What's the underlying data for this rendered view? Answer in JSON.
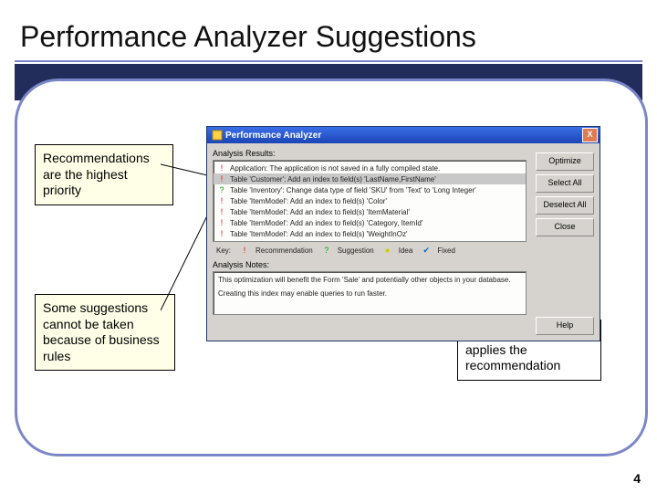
{
  "slide": {
    "title": "Performance Analyzer Suggestions",
    "page_number": "4"
  },
  "callouts": {
    "c1": "Recommendations are the highest priority",
    "c2": "Some suggestions cannot be taken because of business rules",
    "c3": "The optimize button applies the recommendation"
  },
  "dialog": {
    "title": "Performance Analyzer",
    "close": "X",
    "analysis_results_label": "Analysis Results:",
    "results": [
      {
        "icon": "reco",
        "text": "Application: The application is not saved in a fully compiled state."
      },
      {
        "icon": "reco",
        "text": "Table 'Customer': Add an index to field(s) 'LastName,FirstName'"
      },
      {
        "icon": "sugg",
        "text": "Table 'Inventory': Change data type of field 'SKU' from 'Text' to 'Long Integer'"
      },
      {
        "icon": "reco",
        "text": "Table 'ItemModel': Add an index to field(s) 'Color'"
      },
      {
        "icon": "reco",
        "text": "Table 'ItemModel': Add an index to field(s) 'ItemMaterial'"
      },
      {
        "icon": "reco",
        "text": "Table 'ItemModel': Add an index to field(s) 'Category, ItemId'"
      },
      {
        "icon": "reco",
        "text": "Table 'ItemModel': Add an index to field(s) 'WeightInOz'"
      }
    ],
    "key_label": "Key:",
    "key": {
      "recommendation": "Recommendation",
      "suggestion": "Suggestion",
      "idea": "Idea",
      "fixed": "Fixed"
    },
    "analysis_notes_label": "Analysis Notes:",
    "notes_line1": "This optimization will benefit the Form 'Sale' and potentially other objects in your database.",
    "notes_line2": "Creating this index may enable queries to run faster.",
    "buttons": {
      "optimize": "Optimize",
      "select_all": "Select All",
      "deselect_all": "Deselect All",
      "close": "Close",
      "help": "Help"
    }
  }
}
